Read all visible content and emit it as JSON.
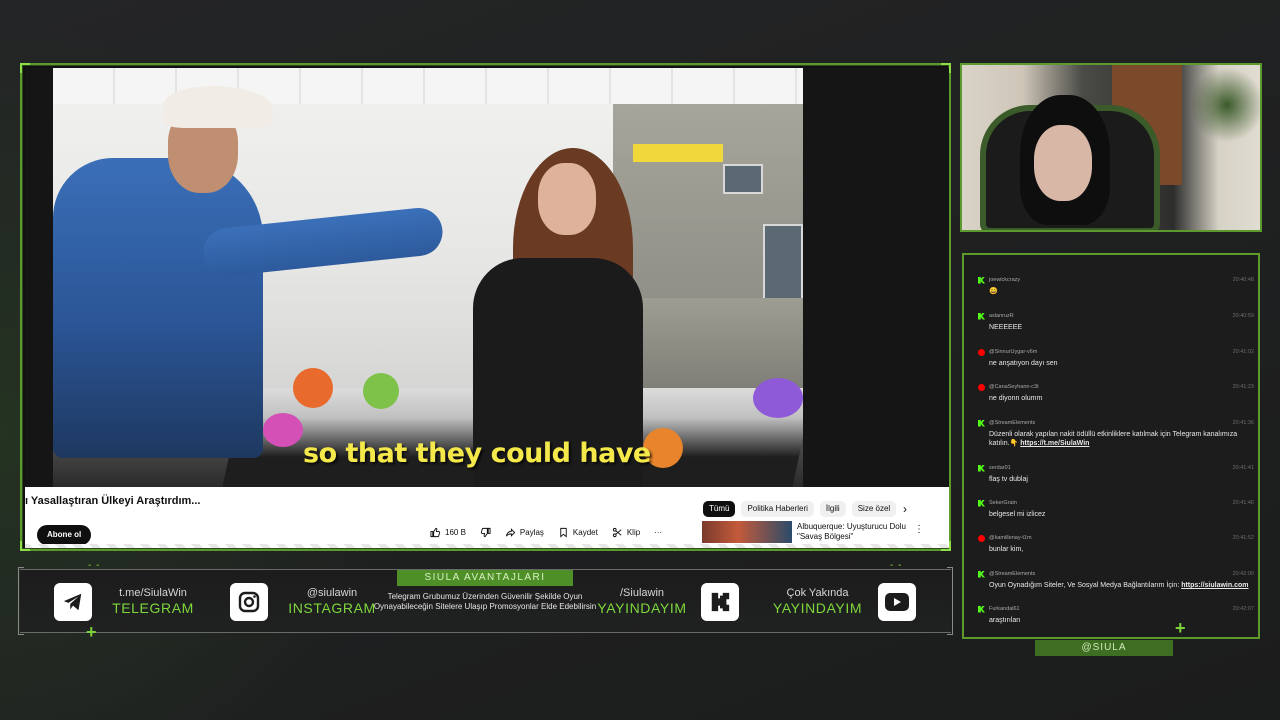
{
  "video": {
    "subtitle": "so that they could have",
    "title": "ı Yasallaştıran Ülkeyi Araştırdım...",
    "subscribe_label": "Abone ol",
    "chips": [
      "Tümü",
      "Politika Haberleri",
      "İlgili",
      "Size özel"
    ],
    "chip_next": "›",
    "like_count": "160 B",
    "share_label": "Paylaş",
    "save_label": "Kaydet",
    "clip_label": "Klip",
    "more_label": "···",
    "recommended_title": "Albuquerque: Uyuşturucu Dolu \"Savaş Bölgesi\"",
    "recommended_more": "⋮"
  },
  "chat": {
    "messages": [
      {
        "platform": "kick",
        "user": "joewickcrazy",
        "time": "20:40:48",
        "text": "😄"
      },
      {
        "platform": "kick",
        "user": "aslanruzR",
        "time": "20:40:59",
        "text": "NEEEEEE"
      },
      {
        "platform": "youtube",
        "user": "@SinnurUygar-v6m",
        "time": "20:41:02",
        "text": "ne anşatıyon dayı sen"
      },
      {
        "platform": "youtube",
        "user": "@CanaSeyhann-c3t",
        "time": "20:41:23",
        "text": "ne diyonn olumm"
      },
      {
        "platform": "kick",
        "user": "@StreamElements",
        "time": "20:41:36",
        "text": "Düzenli olarak yapılan nakit ödüllü etkinliklere katılmak için Telegram kanalımıza katılın.👇 ",
        "link": "https://t.me/SiulaWin"
      },
      {
        "platform": "kick",
        "user": "serdar01",
        "time": "20:41:41",
        "text": "flaş tv dublaj"
      },
      {
        "platform": "kick",
        "user": "SekerGrain",
        "time": "20:41:46",
        "text": "belgesel mi izlicez"
      },
      {
        "platform": "youtube",
        "user": "@kamillenay-t1m",
        "time": "20:41:52",
        "text": "bunlar kim,"
      },
      {
        "platform": "kick",
        "user": "@StreamElements",
        "time": "20:42:00",
        "text": "Oyun Oynadığım Siteler, Ve Sosyal Medya Bağlantılarım İçin: ",
        "link": "https://siulawin.com"
      },
      {
        "platform": "kick",
        "user": "Furkandal61",
        "time": "20:42:07",
        "text": "araştırılan"
      }
    ]
  },
  "chat_tag": "@SIULA",
  "bottom_bar": {
    "telegram": {
      "line1": "t.me/SiulaWin",
      "line2": "TELEGRAM",
      "icon": "telegram-icon"
    },
    "instagram": {
      "line1": "@siulawin",
      "line2": "INSTAGRAM",
      "icon": "instagram-icon"
    },
    "promo_title": "SIULA AVANTAJLARI",
    "promo_text": "Telegram Grubumuz Üzerinden Güvenilir Şekilde Oyun Oynayabileceğin Sitelere Ulaşıp Promosyonlar Elde Edebilirsin",
    "kick": {
      "line1": "/Siulawin",
      "line2": "YAYINDAYIM",
      "icon": "kick-icon"
    },
    "youtube": {
      "line1": "Çok Yakında",
      "line2": "YAYINDAYIM",
      "icon": "youtube-icon"
    }
  },
  "colors": {
    "accent": "#5c9a2e",
    "accent_bright": "#7ed63c",
    "background": "#1e1f1f",
    "subtitle": "#f4e84a"
  }
}
